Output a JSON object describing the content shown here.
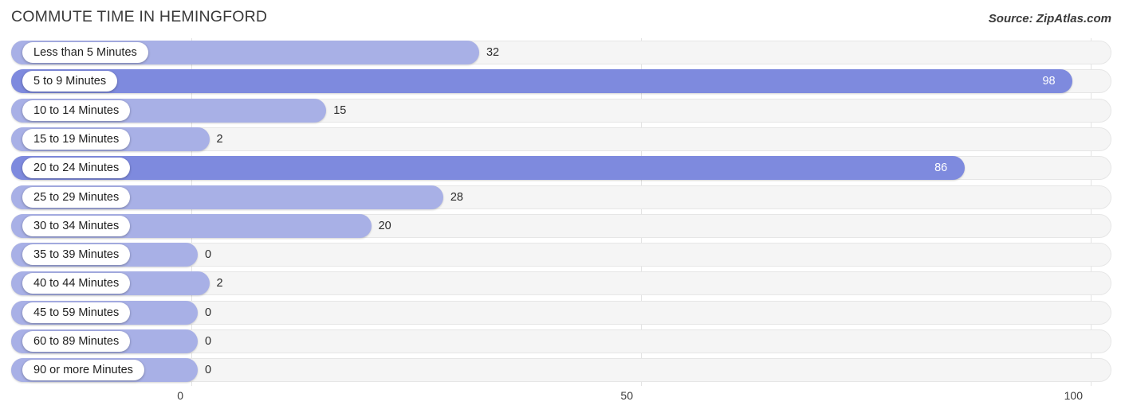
{
  "header": {
    "title": "COMMUTE TIME IN HEMINGFORD",
    "source": "Source: ZipAtlas.com"
  },
  "axis": {
    "ticks": [
      "0",
      "50",
      "100"
    ],
    "tick_values": [
      0,
      50,
      100
    ]
  },
  "colors": {
    "bar_light": "#a8b0e6",
    "bar_dark": "#7e8ade",
    "track": "#f5f5f5",
    "track_border": "#e6e6e6",
    "gridline": "#e3e3e3",
    "text": "#3a3a3a",
    "value_inside": "#ffffff"
  },
  "chart_data": {
    "type": "bar",
    "orientation": "horizontal",
    "title": "COMMUTE TIME IN HEMINGFORD",
    "xlabel": "",
    "ylabel": "",
    "xlim": [
      0,
      100
    ],
    "grid": true,
    "legend": null,
    "categories": [
      "Less than 5 Minutes",
      "5 to 9 Minutes",
      "10 to 14 Minutes",
      "15 to 19 Minutes",
      "20 to 24 Minutes",
      "25 to 29 Minutes",
      "30 to 34 Minutes",
      "35 to 39 Minutes",
      "40 to 44 Minutes",
      "45 to 59 Minutes",
      "60 to 89 Minutes",
      "90 or more Minutes"
    ],
    "values": [
      32,
      98,
      15,
      2,
      86,
      28,
      20,
      0,
      2,
      0,
      0,
      0
    ],
    "value_labels": [
      "32",
      "98",
      "15",
      "2",
      "86",
      "28",
      "20",
      "0",
      "2",
      "0",
      "0",
      "0"
    ],
    "bar_shades": [
      "light",
      "dark",
      "light",
      "light",
      "dark",
      "light",
      "light",
      "light",
      "light",
      "light",
      "light",
      "light"
    ],
    "label_position": [
      "outside",
      "inside",
      "outside",
      "outside",
      "inside",
      "outside",
      "outside",
      "outside",
      "outside",
      "outside",
      "outside",
      "outside"
    ]
  }
}
